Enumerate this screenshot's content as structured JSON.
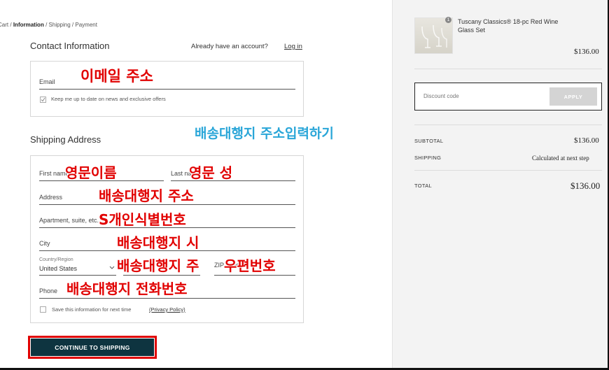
{
  "breadcrumb": {
    "cart": "Cart",
    "sep1": "/",
    "information": "Information",
    "sep2": "/",
    "shipping": "Shipping",
    "sep3": "/",
    "payment": "Payment"
  },
  "contact": {
    "title": "Contact Information",
    "account_prompt": "Already have an account?",
    "login_label": "Log in",
    "email_label": "Email",
    "newsletter_label": "Keep me up to date on news and exclusive offers"
  },
  "shipping": {
    "title": "Shipping Address",
    "first_name_label": "First name",
    "last_name_label": "Last name",
    "address_label": "Address",
    "apartment_label": "Apartment, suite, etc.",
    "city_label": "City",
    "country_caption": "Country/Region",
    "country_value": "United States",
    "zip_label": "ZIP code",
    "phone_label": "Phone",
    "save_info_label": "Save this information for next time",
    "privacy_label": "(Privacy Policy)"
  },
  "continue_button": "CONTINUE TO SHIPPING",
  "annotations": {
    "email": "이메일 주소",
    "title": "배송대행지 주소입력하기",
    "first_name": "영문이름",
    "last_name": "영문 성",
    "address": "배송대행지 주소",
    "apartment": "S개인식별번호",
    "city": "배송대행지 시",
    "state": "배송대행지 주",
    "zip": "우편번호",
    "phone": "배송대행지 전화번호"
  },
  "order": {
    "quantity": "1",
    "product_name": "Tuscany Classics® 18-pc Red Wine Glass Set",
    "product_price": "$136.00",
    "discount_placeholder": "Discount code",
    "apply_label": "APPLY",
    "subtotal_label": "SUBTOTAL",
    "subtotal_value": "$136.00",
    "shipping_label": "SHIPPING",
    "shipping_value": "Calculated at next step",
    "total_label": "TOTAL",
    "total_value": "$136.00"
  },
  "colors": {
    "button_bg": "#0e3440",
    "annotation_red": "#e10000",
    "annotation_cyan": "#2aa6d8"
  }
}
